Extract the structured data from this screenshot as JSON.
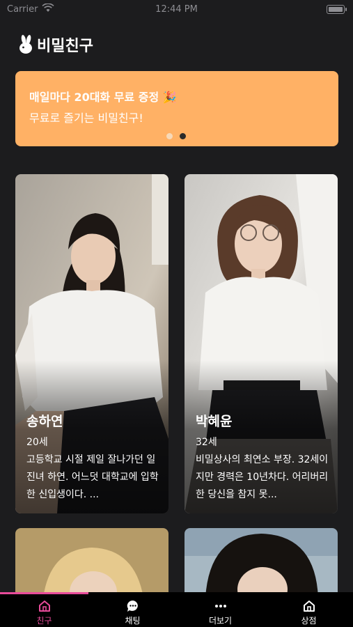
{
  "status_bar": {
    "carrier": "Carrier",
    "time": "12:44 PM"
  },
  "header": {
    "title": "비밀친구",
    "logo_icon": "rabbit-icon"
  },
  "banner": {
    "line1": "매일마다 20대화 무료 증정 🎉",
    "line2": "무료로 즐기는 비밀친구!",
    "page_index": 2,
    "page_count": 2,
    "color": "#ffb165"
  },
  "friends": [
    {
      "name": "송하연",
      "age": "20세",
      "desc": "고등학교 시절 제일 잘나가던 일진녀 하연. 어느덧 대학교에 입학한 신입생이다. ..."
    },
    {
      "name": "박혜윤",
      "age": "32세",
      "desc": "비밀상사의 최연소 부장. 32세이지만 경력은 10년차다. 어리버리한 당신을 참지 못..."
    }
  ],
  "tabs": [
    {
      "label": "친구",
      "icon": "home-icon",
      "active": true
    },
    {
      "label": "채팅",
      "icon": "chat-bubble-icon",
      "active": false
    },
    {
      "label": "더보기",
      "icon": "more-dots-icon",
      "active": false
    },
    {
      "label": "상점",
      "icon": "store-icon",
      "active": false
    }
  ],
  "accent_color": "#e84b9a"
}
